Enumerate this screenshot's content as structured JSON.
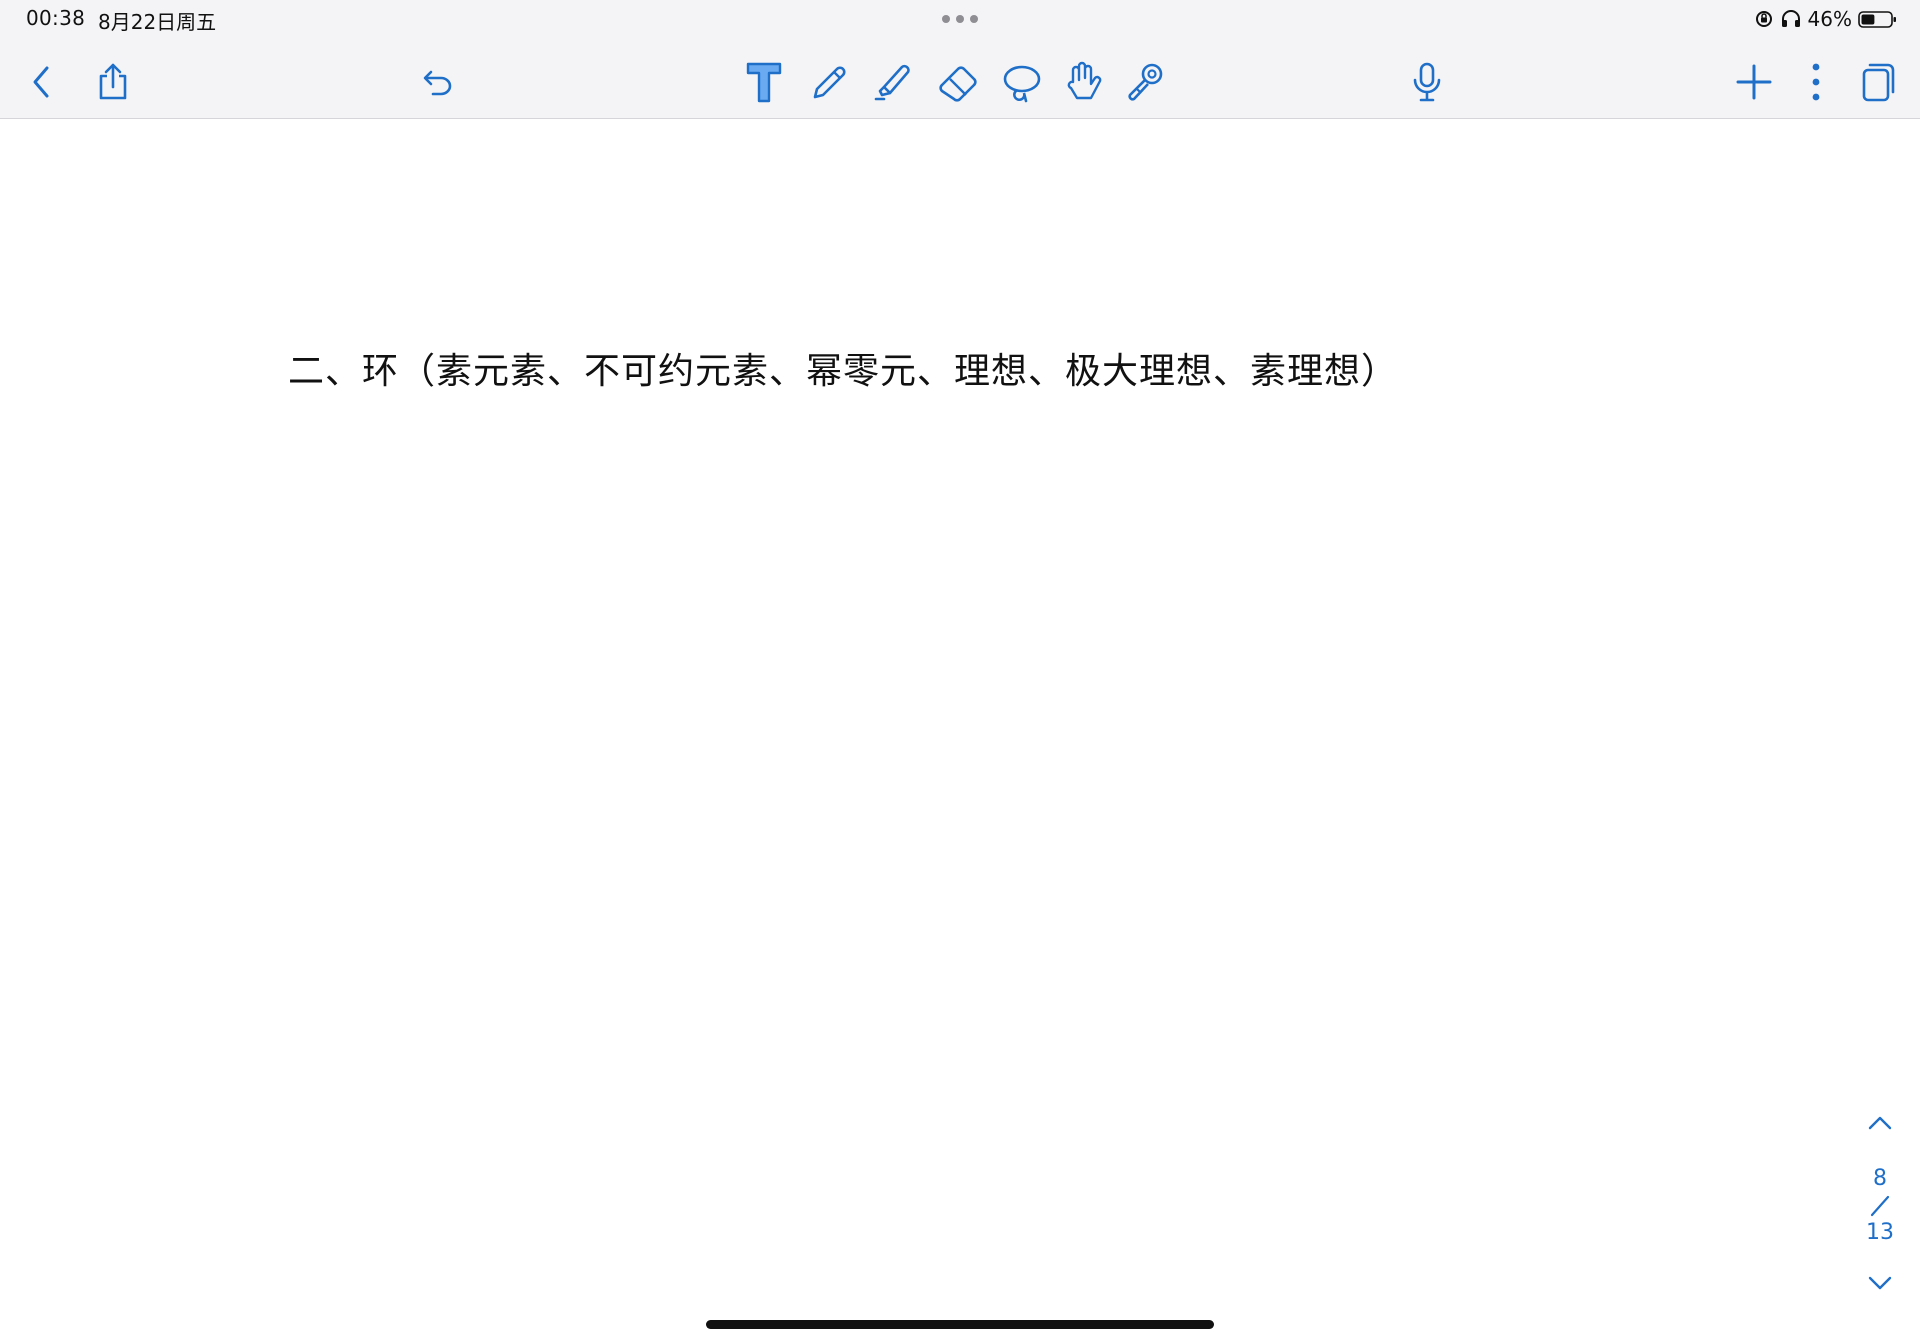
{
  "status_bar": {
    "time": "00:38",
    "date": "8月22日周五",
    "battery_percent": "46%",
    "battery_level": 0.46
  },
  "toolbar": {
    "back_icon": "chevron-left-icon",
    "share_icon": "share-icon",
    "undo_icon": "undo-icon",
    "tools": [
      {
        "name": "text-tool",
        "icon": "text-T-icon",
        "selected": true
      },
      {
        "name": "pen-tool",
        "icon": "pen-icon",
        "selected": false
      },
      {
        "name": "highlighter-tool",
        "icon": "highlighter-icon",
        "selected": false
      },
      {
        "name": "eraser-tool",
        "icon": "eraser-icon",
        "selected": false
      },
      {
        "name": "lasso-tool",
        "icon": "lasso-icon",
        "selected": false
      },
      {
        "name": "hand-tool",
        "icon": "hand-icon",
        "selected": false
      },
      {
        "name": "laser-pointer-tool",
        "icon": "laser-pointer-icon",
        "selected": false
      }
    ],
    "mic_icon": "microphone-icon",
    "add_icon": "plus-icon",
    "more_icon": "more-vertical-icon",
    "pages_icon": "pages-icon",
    "accent_color": "#1f6fc8"
  },
  "document": {
    "heading": "二、环（素元素、不可约元素、幂零元、理想、极大理想、素理想）"
  },
  "page_nav": {
    "current": "8",
    "total": "13"
  }
}
